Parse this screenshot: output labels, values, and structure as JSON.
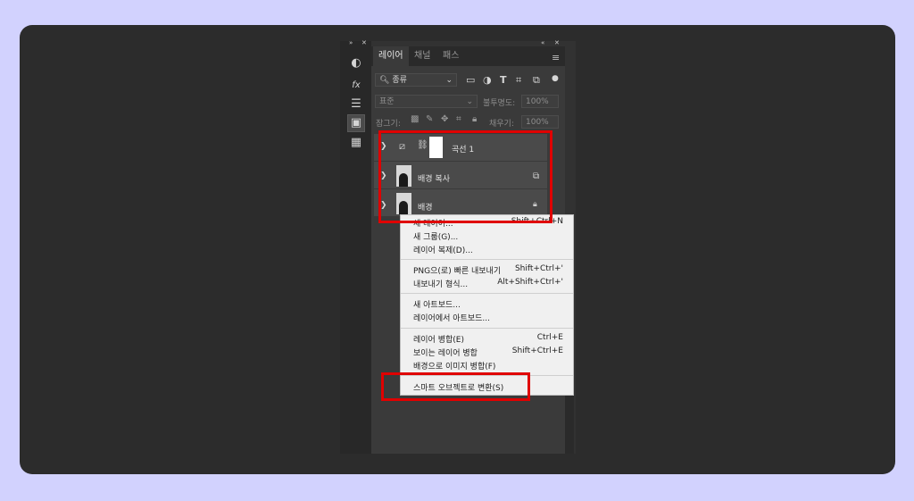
{
  "panel": {
    "tabs": [
      "레이어",
      "채널",
      "패스"
    ],
    "filter": {
      "kind_label": "종류"
    },
    "blend_mode": "표준",
    "opacity_label": "불투명도:",
    "opacity_value": "100%",
    "lock_label": "잠그기:",
    "fill_label": "채우기:",
    "fill_value": "100%"
  },
  "layers": [
    {
      "name": "곡선 1",
      "type": "adjustment"
    },
    {
      "name": "배경 복사",
      "type": "image"
    },
    {
      "name": "배경",
      "type": "image",
      "locked": true
    }
  ],
  "context_menu": {
    "groups": [
      [
        {
          "label": "새 레이어...",
          "shortcut": "Shift+Ctrl+N"
        },
        {
          "label": "새 그룹(G)...",
          "shortcut": ""
        },
        {
          "label": "레이어 복제(D)...",
          "shortcut": ""
        }
      ],
      [
        {
          "label": "PNG으(로) 빠른 내보내기",
          "shortcut": "Shift+Ctrl+'"
        },
        {
          "label": "내보내기 형식...",
          "shortcut": "Alt+Shift+Ctrl+'"
        }
      ],
      [
        {
          "label": "새 아트보드...",
          "shortcut": ""
        },
        {
          "label": "레이어에서 아트보드...",
          "shortcut": ""
        }
      ],
      [
        {
          "label": "레이어 병합(E)",
          "shortcut": "Ctrl+E"
        },
        {
          "label": "보이는 레이어 병합",
          "shortcut": "Shift+Ctrl+E"
        },
        {
          "label": "배경으로 이미지 병합(F)",
          "shortcut": ""
        }
      ],
      [
        {
          "label": "스마트 오브젝트로 변환(S)",
          "shortcut": ""
        }
      ]
    ]
  },
  "icons": {
    "tools": [
      "adjustments-icon",
      "styles-icon",
      "properties-icon",
      "libraries-icon",
      "grid-icon"
    ],
    "filters": [
      "pixel-layer-filter-icon",
      "adjustment-filter-icon",
      "type-filter-icon",
      "shape-filter-icon",
      "smart-object-filter-icon",
      "toggle-filter-icon"
    ]
  },
  "colors": {
    "highlight": "#e00000",
    "menu_bg": "#f0f0f0",
    "panel_bg": "#3a3a3a"
  }
}
